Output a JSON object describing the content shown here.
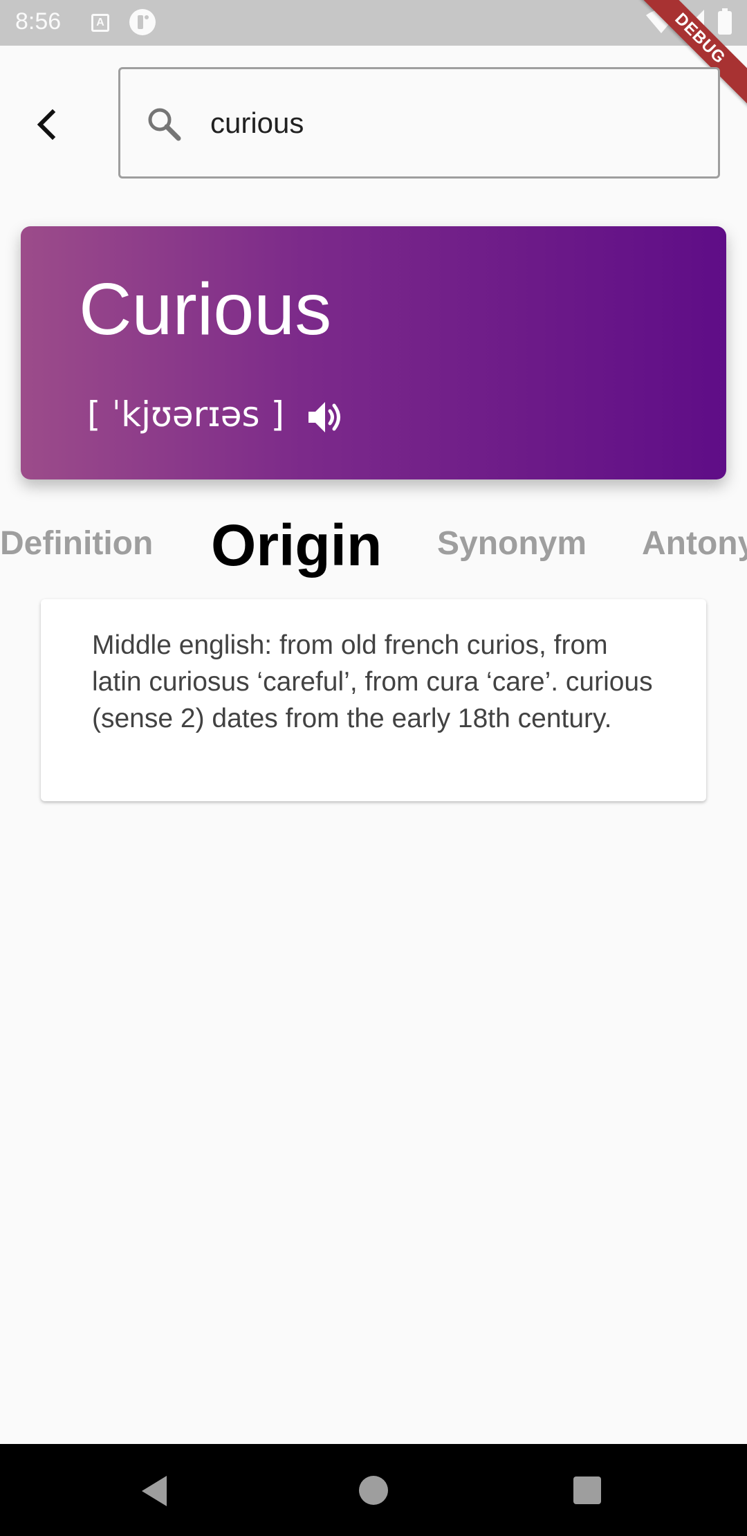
{
  "status_bar": {
    "time": "8:56",
    "icons": [
      "a-notification-icon",
      "p-notification-icon",
      "wifi-icon",
      "signal-icon",
      "battery-icon"
    ]
  },
  "debug_banner": "DEBUG",
  "search": {
    "value": "curious",
    "placeholder": ""
  },
  "word_card": {
    "word": "Curious",
    "phonetic": "[ ˈkjʊərɪəs ]",
    "gradient_colors": [
      "#9c4c8a",
      "#5f0d87"
    ]
  },
  "tabs": [
    {
      "label": "Definition",
      "active": false
    },
    {
      "label": "Origin",
      "active": true
    },
    {
      "label": "Synonym",
      "active": false
    },
    {
      "label": "Antony",
      "active": false
    }
  ],
  "content": {
    "text": "Middle english: from old french curios, from latin curiosus ‘careful’, from cura ‘care’. curious (sense 2) dates from the early 18th century."
  },
  "nav_bar": {
    "icons": [
      "back-triangle-icon",
      "home-circle-icon",
      "recents-square-icon"
    ]
  }
}
